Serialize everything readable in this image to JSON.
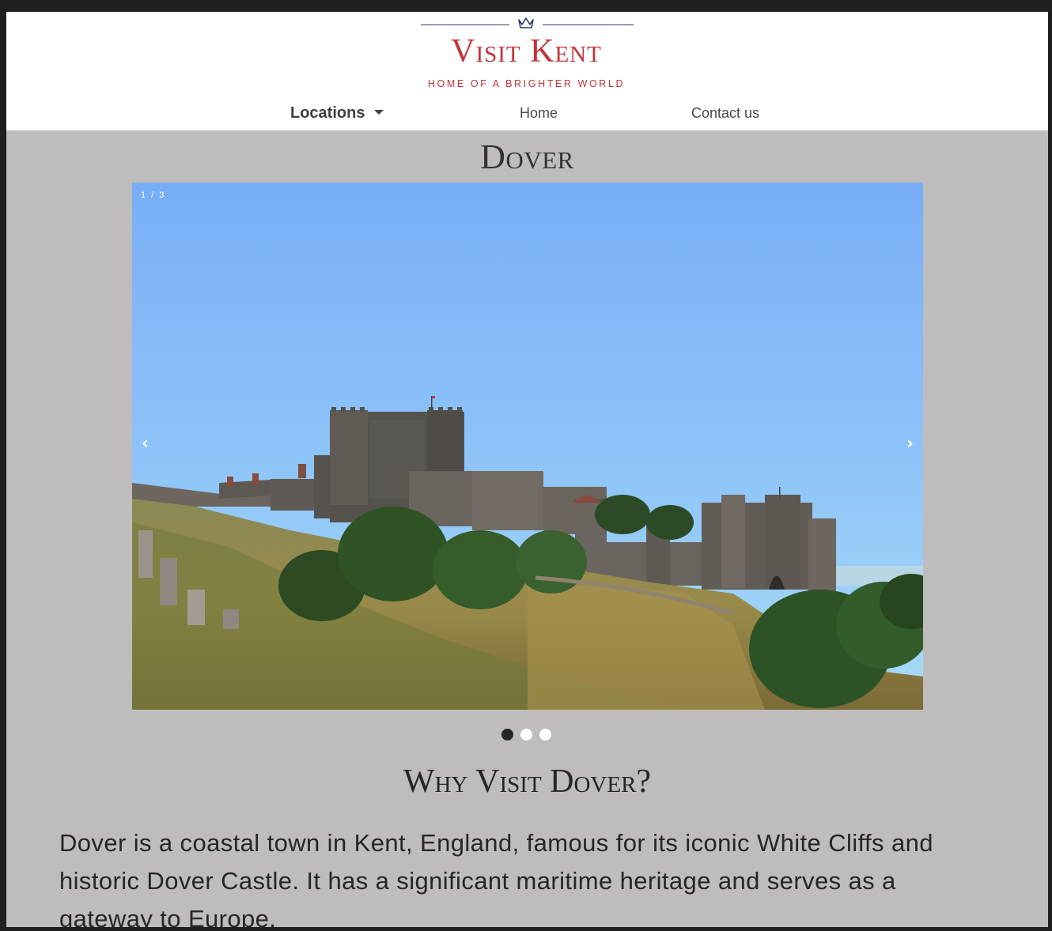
{
  "header": {
    "logo_title": "Visit Kent",
    "logo_tagline": "HOME OF A BRIGHTER WORLD",
    "nav": {
      "locations": "Locations",
      "home": "Home",
      "contact": "Contact us"
    }
  },
  "main": {
    "title": "Dover",
    "carousel": {
      "counter": "1 / 3",
      "prev": "‹",
      "next": "›"
    },
    "section_title": "Why Visit Dover?",
    "description": "Dover is a coastal town in Kent, England, famous for its iconic White Cliffs and historic Dover Castle. It has a significant maritime heritage and serves as a gateway to Europe."
  },
  "colors": {
    "brand_red": "#c2333a",
    "navy": "#2d3a6b",
    "page_bg": "#bebcbd"
  }
}
